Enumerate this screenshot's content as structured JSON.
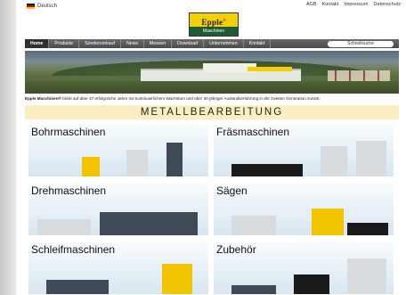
{
  "topbar": {
    "language": "Deutsch",
    "links": [
      "AGB",
      "Kontakt",
      "Impressum",
      "Datenschutz"
    ]
  },
  "logo": {
    "name": "Epple",
    "sub": "Maschinen"
  },
  "nav": {
    "items": [
      "Home",
      "Produkte",
      "Sonderverkauf",
      "News",
      "Messen",
      "Download",
      "Unternehmen",
      "Kontakt"
    ],
    "search_placeholder": "Schnellsuche"
  },
  "tagline": {
    "brand": "Epple Maschinen®",
    "text": " blickt auf über 47 erfolgreiche Jahre mit kontinuierlichem Wachstum und über 30-jähriger Auslandserfahrung in der zweiten Generation zurück."
  },
  "section_title": "METALLBEARBEITUNG",
  "categories": [
    "Bohrmaschinen",
    "Fräsmaschinen",
    "Drehmaschinen",
    "Sägen",
    "Schleifmaschinen",
    "Zubehör"
  ],
  "colors": {
    "brand_yellow": "#f4d000",
    "brand_green": "#1e5a36",
    "nav_gray": "#5a5a5a",
    "title_band": "#fbeec0"
  }
}
